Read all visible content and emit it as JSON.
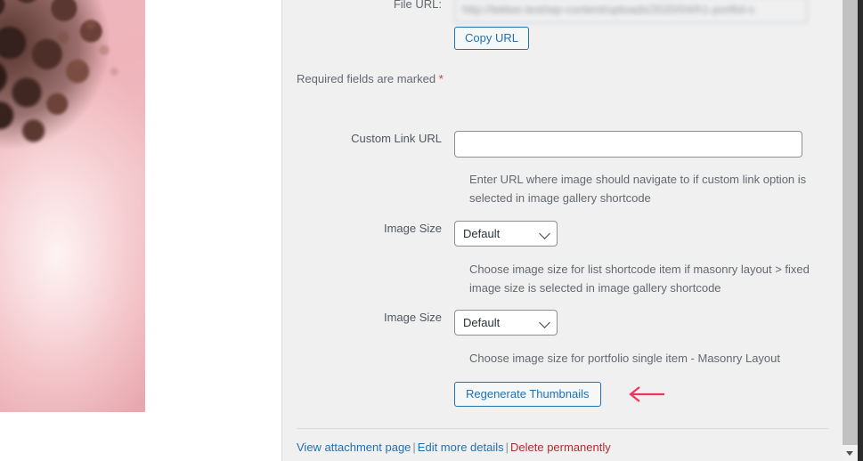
{
  "preview": {
    "alt": "portfolio attachment preview photo",
    "description": "Pink background portrait with dark curly hair in upper left"
  },
  "panel": {
    "file_url": {
      "label": "File URL:",
      "value": "http://tekker.test/wp-content/uploads/2020/04/h1-portfol-s",
      "readonly": true,
      "copy_button": "Copy URL"
    },
    "required_note": {
      "text": "Required fields are marked ",
      "marker": "*",
      "marker_color": "#d63638"
    },
    "fields": [
      {
        "label": "Custom Link URL",
        "type": "text",
        "value": "",
        "placeholder": "",
        "helper": "Enter URL where image should navigate to if custom link option is selected in image gallery shortcode"
      },
      {
        "label": "Image Size",
        "type": "select",
        "value": "Default",
        "options": [
          "Default"
        ],
        "helper": "Choose image size for list shortcode item if masonry layout > fixed image size is selected in image gallery shortcode"
      },
      {
        "label": "Image Size",
        "type": "select",
        "value": "Default",
        "options": [
          "Default"
        ],
        "helper": "Choose image size for portfolio single item - Masonry Layout"
      }
    ],
    "regenerate_button": "Regenerate Thumbnails",
    "annotation": {
      "type": "left-arrow",
      "color": "#e8395f"
    },
    "footer": {
      "view_attachment": "View attachment page",
      "edit_details": "Edit more details",
      "delete": "Delete permanently",
      "separator": "|"
    }
  },
  "scrollbar": {
    "orientation": "vertical",
    "position_percent": 0,
    "down_arrow": "▼"
  },
  "colors": {
    "panel_background": "#f0f0f1",
    "link_blue": "#2271b1",
    "danger_red": "#b32d2e",
    "label_gray": "#646970",
    "annotation_pink": "#e8395f"
  }
}
